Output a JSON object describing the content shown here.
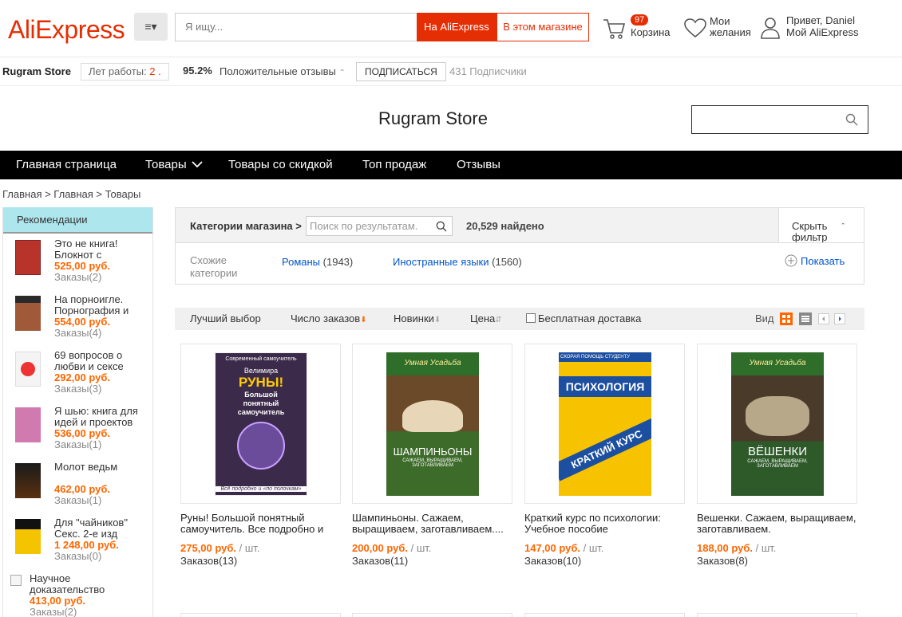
{
  "header": {
    "logo": "AliExpress",
    "menu_icon": "≡▾",
    "search_placeholder": "Я ищу...",
    "btn_ali": "На AliExpress",
    "btn_store": "В этом магазине",
    "cart_count": "97",
    "cart_label": "Корзина",
    "wish_label": "Мои желания",
    "account_greeting": "Привет, Daniel",
    "account_link": "Мой AliExpress"
  },
  "storebar": {
    "name": "Rugram Store",
    "years_label": "Лет работы:",
    "years_value": "2 .",
    "positive_pct": "95.2%",
    "positive_label": "Положительные отзывы",
    "subscribe": "ПОДПИСАТЬСЯ",
    "followers": "431 Подписчики"
  },
  "store_title": "Rugram Store",
  "nav": [
    "Главная страница",
    "Товары",
    "Товары со скидкой",
    "Топ продаж",
    "Отзывы"
  ],
  "breadcrumb": "Главная > Главная > Товары",
  "sidebar": {
    "heading": "Рекомендации",
    "items": [
      {
        "title": "Это не книга! Блокнот с",
        "price": "525,00 руб.",
        "orders": "Заказы(2)"
      },
      {
        "title": "На порноигле. Порнография и",
        "price": "554,00 руб.",
        "orders": "Заказы(4)"
      },
      {
        "title": "69 вопросов о любви и сексе",
        "price": "292,00 руб.",
        "orders": "Заказы(3)"
      },
      {
        "title": "Я шью: книга для идей и проектов",
        "price": "536,00 руб.",
        "orders": "Заказы(1)"
      },
      {
        "title": "Молот ведьм",
        "price": "462,00 руб.",
        "orders": "Заказы(1)"
      },
      {
        "title": "Для \"чайников\" Секс. 2-е изд",
        "price": "1 248,00 руб.",
        "orders": "Заказы(0)"
      },
      {
        "title": "Научное доказательство",
        "price": "413,00 руб.",
        "orders": "Заказы(2)"
      }
    ]
  },
  "filter": {
    "categories_label": "Категории магазина >",
    "search_placeholder": "Поиск по результатам.",
    "found": "20,529 найдено",
    "hide_label": "Скрыть фильтр",
    "similar_label": "Схожие категории",
    "similar": [
      {
        "name": "Романы",
        "count": "(1943)"
      },
      {
        "name": "Иностранные языки",
        "count": "(1560)"
      }
    ],
    "show_label": "Показать"
  },
  "sort": {
    "best": "Лучший выбор",
    "orders": "Число заказов",
    "newest": "Новинки",
    "price": "Цена",
    "free_shipping": "Бесплатная доставка",
    "view_label": "Вид"
  },
  "products": [
    {
      "title": "Руны! Большой понятный самоучитель. Все подробно и",
      "price": "275,00 руб.",
      "unit": "/ шт.",
      "orders": "Заказов(13)"
    },
    {
      "title": "Шампиньоны. Сажаем, выращиваем, заготавливаем....",
      "price": "200,00 руб.",
      "unit": "/ шт.",
      "orders": "Заказов(11)"
    },
    {
      "title": "Краткий курс по психологии: Учебное пособие",
      "price": "147,00 руб.",
      "unit": "/ шт.",
      "orders": "Заказов(10)"
    },
    {
      "title": "Вешенки. Сажаем, выращиваем, заготавливаем.",
      "price": "188,00 руб.",
      "unit": "/ шт.",
      "orders": "Заказов(8)"
    }
  ],
  "covers": {
    "runes": {
      "series": "Современный самоучитель",
      "author": "Велимира",
      "title": "РУНЫ!",
      "subtitle": "Большой понятный самоучитель",
      "bottom": "Всё подробно и «по полочкам»"
    },
    "champignons": {
      "series": "Умная Усадьба",
      "title": "ШАМПИНЬОНЫ",
      "subtitle": "САЖАЕМ, ВЫРАЩИВАЕМ, ЗАГОТАВЛИВАЕМ"
    },
    "psychology": {
      "series": "СКОРАЯ ПОМОЩЬ СТУДЕНТУ",
      "title": "ПСИХОЛОГИЯ",
      "subtitle": "КРАТКИЙ КУРС"
    },
    "oyster": {
      "series": "Умная Усадьба",
      "title": "ВЁШЕНКИ",
      "subtitle": "САЖАЕМ, ВЫРАЩИВАЕМ, ЗАГОТАВЛИВАЕМ"
    }
  },
  "colors": {
    "accent": "#e62e04",
    "price": "#ff6600",
    "link": "#0055cc",
    "sidebar_head": "#aee6ee"
  }
}
